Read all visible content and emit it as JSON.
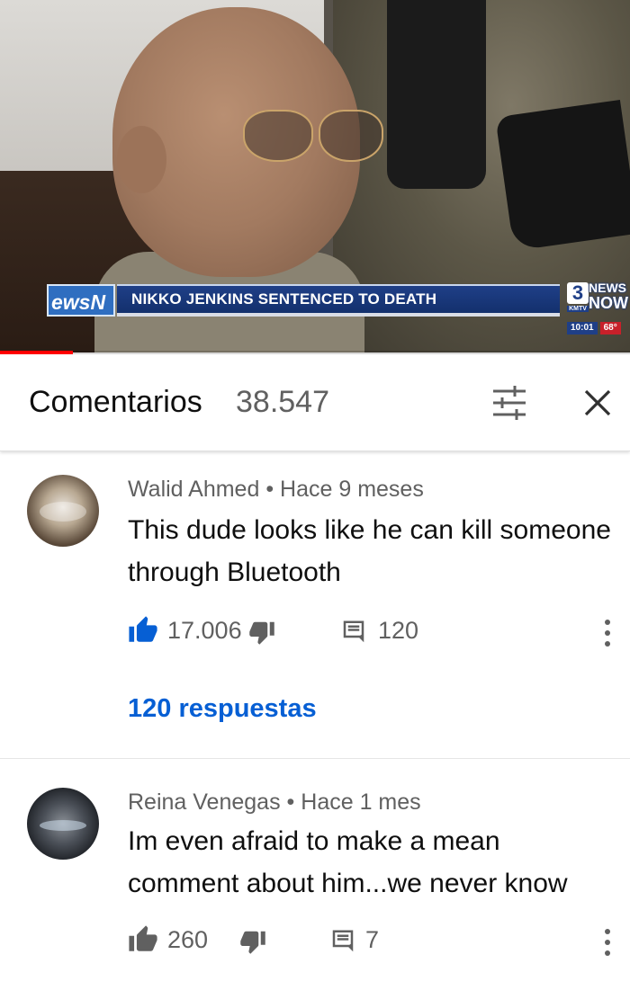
{
  "video": {
    "lower_third_tag": "ewsN",
    "headline": "NIKKO JENKINS SENTENCED TO DEATH",
    "station_number": "3",
    "station_call": "KMTV",
    "station_news": "NEWS",
    "station_now": "NOW",
    "clock": "10:01",
    "temperature": "68°",
    "progress_fraction": 0.115,
    "progress_color": "#ff0000"
  },
  "comments_header": {
    "title": "Comentarios",
    "count": "38.547",
    "sort_icon": "sort-filter-icon",
    "close_icon": "close-icon"
  },
  "comments": [
    {
      "author": "Walid Ahmed",
      "separator": "•",
      "time": "Hace 9 meses",
      "text": "This dude looks like he can kill someone through Bluetooth",
      "likes": "17.006",
      "like_active": true,
      "replies_count": "120",
      "replies_link": "120 respuestas"
    },
    {
      "author": "Reina Venegas",
      "separator": "•",
      "time": "Hace 1 mes",
      "text": "Im even afraid to make a mean comment about him...we never know",
      "likes": "260",
      "like_active": false,
      "replies_count": "7"
    }
  ],
  "colors": {
    "accent_blue": "#065fd4",
    "secondary_text": "#606060",
    "primary_text": "#0f0f0f"
  }
}
